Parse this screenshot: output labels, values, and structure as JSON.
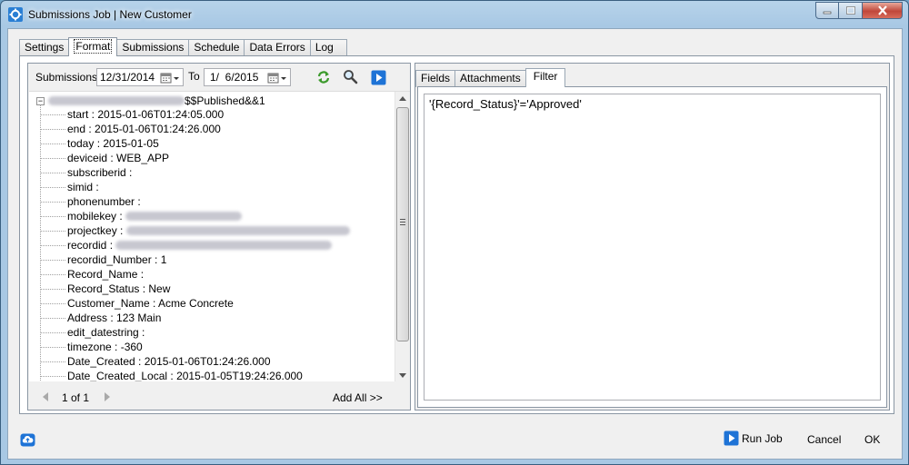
{
  "window": {
    "title": "Submissions Job | New Customer"
  },
  "tabs": [
    "Settings",
    "Format",
    "Submissions",
    "Schedule",
    "Data Errors",
    "Log"
  ],
  "active_tab": "Format",
  "submissions_filter": {
    "label": "Submissions",
    "from_date": "12/31/2014",
    "to_label": "To",
    "to_date": "1/  6/2015"
  },
  "tree": {
    "root_suffix": "$$Published&&1",
    "items": [
      {
        "label": "start : 2015-01-06T01:24:05.000"
      },
      {
        "label": "end : 2015-01-06T01:24:26.000"
      },
      {
        "label": "today : 2015-01-05"
      },
      {
        "label": "deviceid : WEB_APP"
      },
      {
        "label": "subscriberid :"
      },
      {
        "label": "simid :"
      },
      {
        "label": "phonenumber :"
      },
      {
        "label": "mobilekey :"
      },
      {
        "label": "projectkey :"
      },
      {
        "label": "recordid :"
      },
      {
        "label": "recordid_Number : 1"
      },
      {
        "label": "Record_Name :"
      },
      {
        "label": "Record_Status : New"
      },
      {
        "label": "Customer_Name : Acme Concrete"
      },
      {
        "label": "Address : 123 Main"
      },
      {
        "label": "edit_datestring :"
      },
      {
        "label": "timezone : -360"
      },
      {
        "label": "Date_Created : 2015-01-06T01:24:26.000"
      },
      {
        "label": "Date_Created_Local : 2015-01-05T19:24:26.000"
      }
    ]
  },
  "pager": {
    "page_text": "1 of 1",
    "add_all": "Add All >>"
  },
  "subtabs": [
    "Fields",
    "Attachments",
    "Filter"
  ],
  "active_subtab": "Filter",
  "filter_expression": "'{Record_Status}'='Approved'",
  "footer": {
    "run_job": "Run Job",
    "cancel": "Cancel",
    "ok": "OK"
  },
  "colors": {
    "accent": "#1e73d6",
    "refresh": "#3c9a2c"
  },
  "icons": [
    "gear-icon",
    "calendar-icon",
    "refresh-icon",
    "search-icon",
    "play-icon",
    "cloud-upload-icon"
  ]
}
